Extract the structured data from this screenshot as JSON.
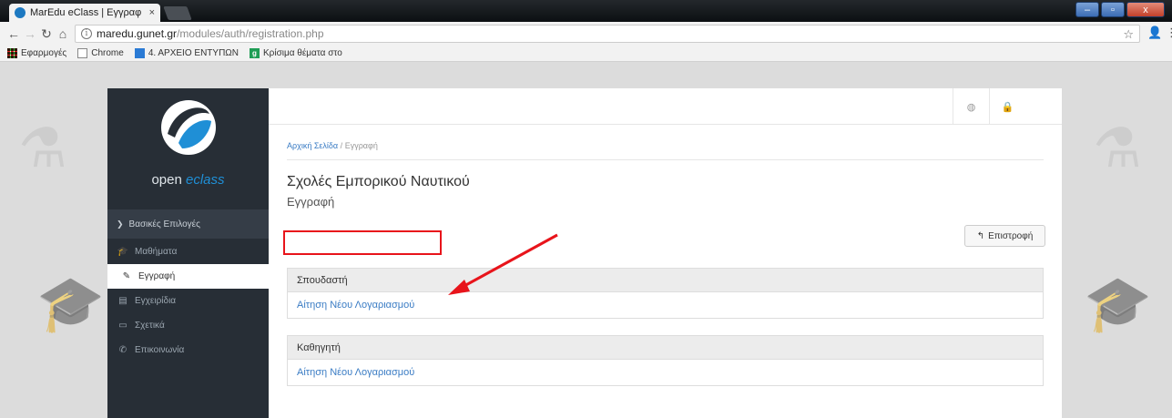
{
  "browser": {
    "tab_title": "MarEdu eClass | Εγγραφ",
    "tab_close": "×",
    "url_host": "maredu.gunet.gr",
    "url_path": "/modules/auth/registration.php",
    "win_minimize": "–",
    "win_maximize": "▫",
    "win_close": "x",
    "bookmarks": [
      {
        "label": "Εφαρμογές",
        "icon": "apps-icon"
      },
      {
        "label": "Chrome",
        "icon": "page-icon"
      },
      {
        "label": "4. ΑΡΧΕΙΟ ΕΝΤΥΠΩΝ",
        "icon": "docs-icon"
      },
      {
        "label": "Κρίσιμα θέματα στο",
        "icon": "g-icon"
      }
    ]
  },
  "sidebar": {
    "brand_prefix": "open ",
    "brand_accent": "eclass",
    "section_label": "Βασικές Επιλογές",
    "items": [
      {
        "label": "Μαθήματα",
        "icon": "graduation-cap-icon",
        "active": false
      },
      {
        "label": "Εγγραφή",
        "icon": "edit-icon",
        "active": true
      },
      {
        "label": "Εγχειρίδια",
        "icon": "document-icon",
        "active": false
      },
      {
        "label": "Σχετικά",
        "icon": "id-card-icon",
        "active": false
      },
      {
        "label": "Επικοινωνία",
        "icon": "phone-icon",
        "active": false
      }
    ]
  },
  "main": {
    "breadcrumb_home": "Αρχική Σελίδα",
    "breadcrumb_sep": "/",
    "breadcrumb_current": "Εγγραφή",
    "title": "Σχολές Εμπορικού Ναυτικού",
    "subtitle": "Εγγραφή",
    "back_label": "Επιστροφή",
    "panels": [
      {
        "heading": "Σπουδαστή",
        "link": "Αίτηση Νέου Λογαριασμού"
      },
      {
        "heading": "Καθηγητή",
        "link": "Αίτηση Νέου Λογαριασμού"
      }
    ]
  },
  "colors": {
    "sidebar_bg": "#272e36",
    "link": "#3a7cc4",
    "annotation": "#e8141b"
  }
}
